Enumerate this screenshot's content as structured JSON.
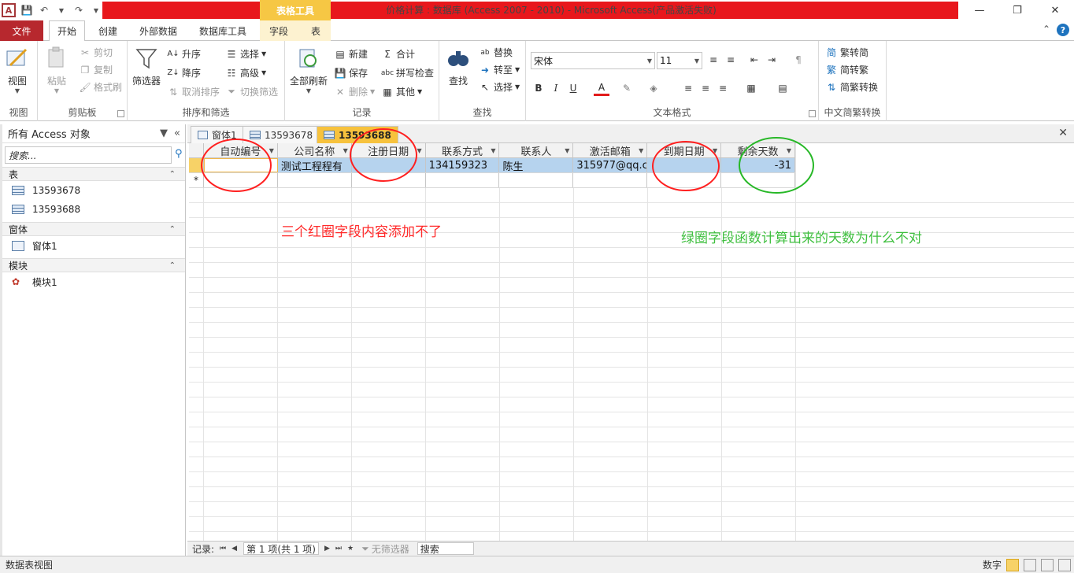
{
  "titlebar": {
    "app_icon": "A",
    "context_group": "表格工具",
    "title": "价格计算 : 数据库 (Access 2007 - 2010) -  Microsoft Access(产品激活失败)"
  },
  "tabs": {
    "file": "文件",
    "items": [
      "开始",
      "创建",
      "外部数据",
      "数据库工具",
      "字段",
      "表"
    ],
    "active": "开始"
  },
  "ribbon": {
    "views": {
      "view": "视图",
      "group": "视图"
    },
    "clipboard": {
      "paste": "粘贴",
      "cut": "剪切",
      "copy": "复制",
      "format_painter": "格式刷",
      "group": "剪贴板"
    },
    "sort_filter": {
      "filter": "筛选器",
      "ascending": "升序",
      "descending": "降序",
      "clear_sort": "取消排序",
      "selection": "选择",
      "advanced": "高级",
      "toggle_filter": "切换筛选",
      "group": "排序和筛选"
    },
    "records": {
      "refresh_all": "全部刷新",
      "new": "新建",
      "save": "保存",
      "delete": "删除",
      "totals": "合计",
      "spelling": "拼写检查",
      "more": "其他",
      "group": "记录"
    },
    "find": {
      "find": "查找",
      "replace": "替换",
      "goto": "转至",
      "select": "选择",
      "group": "查找"
    },
    "text_format": {
      "font": "宋体",
      "size": "11",
      "group": "文本格式"
    },
    "chinese": {
      "to_simplified": "繁转简",
      "to_traditional": "简转繁",
      "convert": "简繁转换",
      "group": "中文简繁转换"
    }
  },
  "nav": {
    "header": "所有 Access 对象",
    "search_placeholder": "搜索...",
    "sections": [
      {
        "title": "表",
        "items": [
          "13593678",
          "13593688"
        ]
      },
      {
        "title": "窗体",
        "items": [
          "窗体1"
        ]
      },
      {
        "title": "模块",
        "items": [
          "模块1"
        ]
      }
    ]
  },
  "doc_tabs": [
    "窗体1",
    "13593678",
    "13593688"
  ],
  "table": {
    "columns": [
      "自动编号",
      "公司名称",
      "注册日期",
      "联系方式",
      "联系人",
      "激活邮箱",
      "到期日期",
      "剩余天数"
    ],
    "rows": [
      [
        "",
        "测试工程程有",
        "",
        "134159323",
        "陈生",
        "315977@qq.c",
        "",
        "-31"
      ]
    ],
    "new_row_marker": "*"
  },
  "annotations": {
    "red": "三个红圈字段内容添加不了",
    "green": "绿圈字段函数计算出来的天数为什么不对"
  },
  "recnav": {
    "label": "记录:",
    "position": "第 1 项(共 1 项)",
    "filter": "无筛选器",
    "search": "搜索"
  },
  "status": {
    "left": "数据表视图",
    "right": "数字"
  },
  "colors": {
    "red_title_bar": "#e8171c",
    "context_tab": "#f6c744",
    "file_tab": "#b7282e",
    "selected_row": "#b6d3ee",
    "annotation_red": "#ff2a2a",
    "annotation_green": "#3fbf3f"
  }
}
